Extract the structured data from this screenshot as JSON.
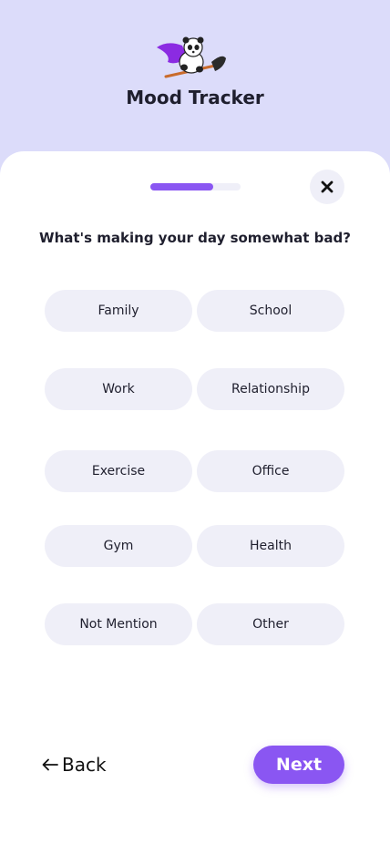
{
  "app": {
    "title": "Mood Tracker"
  },
  "progress": {
    "fraction": 0.7
  },
  "question": "What's making your day somewhat bad?",
  "options": [
    "Family",
    "School",
    "Work",
    "Relationship",
    "Exercise",
    "Office",
    "Gym",
    "Health",
    "Not Mention",
    "Other"
  ],
  "footer": {
    "back_label": "Back",
    "next_label": "Next"
  },
  "colors": {
    "accent": "#8a56f2",
    "header_bg": "#dcdcfa",
    "chip_bg": "#efeff8",
    "text": "#1f1f2e"
  },
  "icons": {
    "logo": "panda-on-broom-logo",
    "close": "close-icon",
    "back": "arrow-left-icon"
  }
}
